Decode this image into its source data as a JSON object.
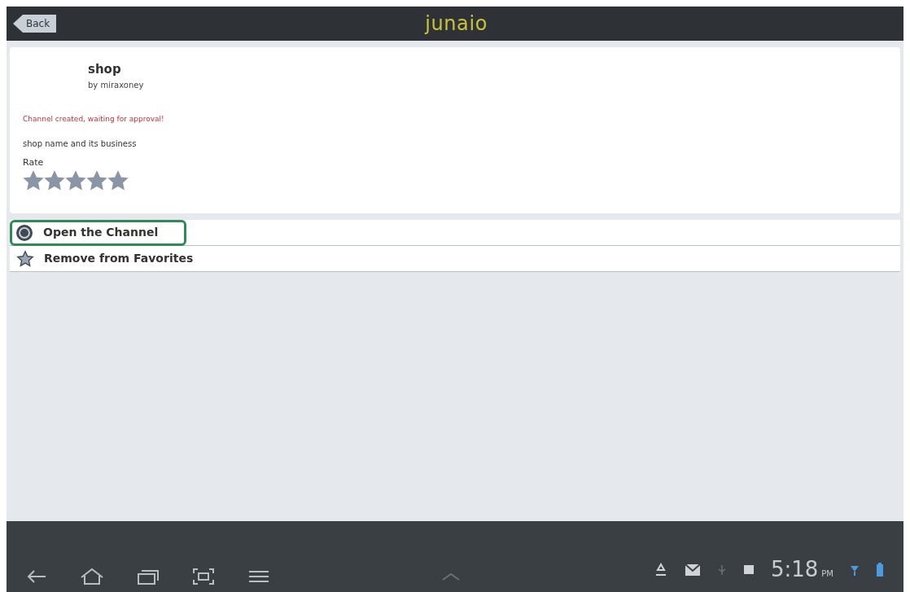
{
  "action_bar": {
    "back_label": "Back",
    "logo": "junaio"
  },
  "channel": {
    "title": "shop",
    "author": "by miraxoney",
    "status": "Channel created, waiting for approval!",
    "description": "shop name and its business",
    "rate_label": "Rate",
    "stars": 5
  },
  "menu": [
    {
      "kind": "open",
      "label": "Open the Channel",
      "highlighted": true
    },
    {
      "kind": "favorite",
      "label": "Remove from Favorites",
      "highlighted": false
    }
  ],
  "status_bar": {
    "time": "5:18",
    "meridiem": "PM"
  }
}
